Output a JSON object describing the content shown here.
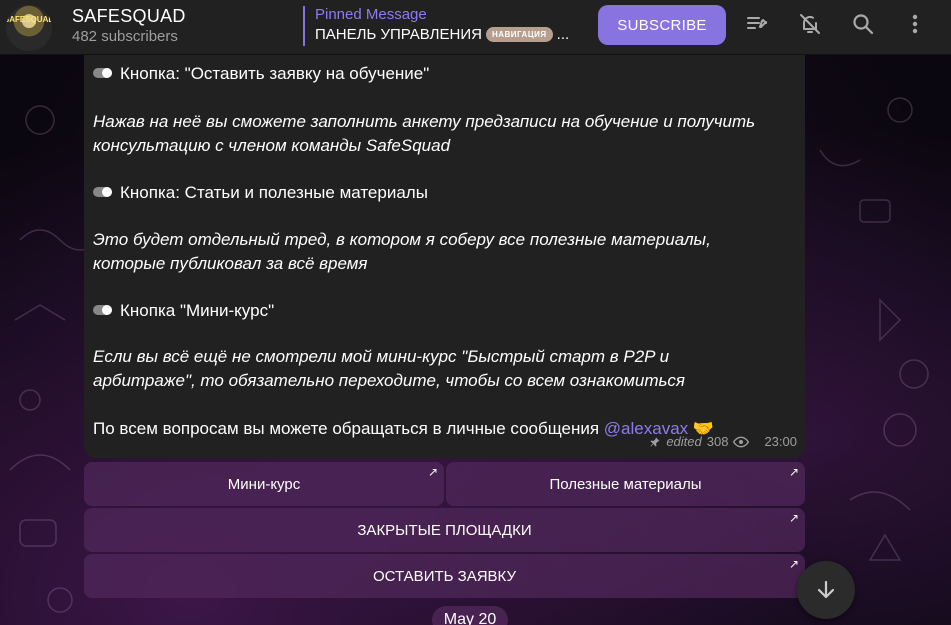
{
  "header": {
    "channel_name": "SAFESQUAD",
    "subscribers": "482 subscribers",
    "avatar_text": "SAFESQUAD",
    "pinned_title": "Pinned Message",
    "pinned_text": "ПАНЕЛЬ УПРАВЛЕНИЯ",
    "pinned_badge": "НАВИГАЦИЯ",
    "pinned_ellipsis": "...",
    "subscribe_label": "SUBSCRIBE",
    "icons": [
      "pinned-list-icon",
      "mute-bell-icon",
      "search-icon",
      "more-vert-icon"
    ]
  },
  "message": {
    "lines": {
      "l1": "Кнопка: \"Оставить заявку на обучение\"",
      "l2": "Нажав на неё вы сможете заполнить анкету предзаписи на обучение и получить",
      "l3": "консультацию с членом команды SafeSquad",
      "l4": "Кнопка: Статьи и полезные материалы",
      "l5": "Это будет отдельный тред, в котором я соберу все полезные материалы,",
      "l6": "которые публиковал за всё время",
      "l7": "Кнопка \"Мини-курс\"",
      "l8": "Если вы всё ещё не смотрели мой мини-курс \"Быстрый старт в P2P и",
      "l9": "арбитраже\", то обязательно переходите, чтобы со всем ознакомиться",
      "l10": "По всем вопросам вы можете обращаться в личные сообщения ",
      "mention": "@alexavax",
      "emoji": "🤝"
    },
    "edited": "edited",
    "views": "308",
    "time": "23:00"
  },
  "buttons": {
    "mini_course": "Мини-курс",
    "useful_materials": "Полезные материалы",
    "closed_platforms": "ЗАКРЫТЫЕ ПЛОЩАДКИ",
    "leave_request": "ОСТАВИТЬ ЗАЯВКУ",
    "arrow": "↗"
  },
  "date_pill": "May 20",
  "colors": {
    "accent": "#8774e1",
    "header_bg": "#212121",
    "bubble_bg": "#212121",
    "inline_button_bg": "#50285a"
  }
}
